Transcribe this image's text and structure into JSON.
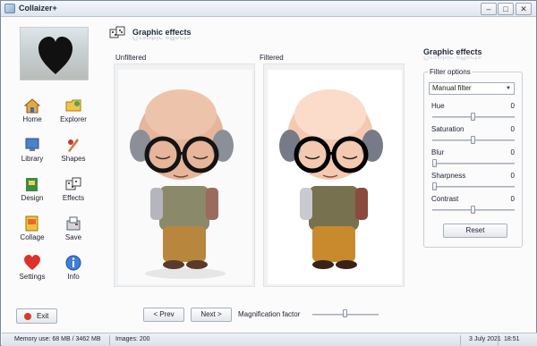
{
  "window": {
    "title": "Collaizer+",
    "min_glyph": "–",
    "max_glyph": "□",
    "close_glyph": "✕"
  },
  "sidebar": {
    "items": [
      {
        "label": "Home",
        "icon": "house-icon"
      },
      {
        "label": "Explorer",
        "icon": "folder-explorer-icon"
      },
      {
        "label": "Library",
        "icon": "monitor-library-icon"
      },
      {
        "label": "Shapes",
        "icon": "shapes-icon"
      },
      {
        "label": "Design",
        "icon": "design-icon"
      },
      {
        "label": "Effects",
        "icon": "dice-effects-icon"
      },
      {
        "label": "Collage",
        "icon": "collage-icon"
      },
      {
        "label": "Save",
        "icon": "save-icon"
      },
      {
        "label": "Settings",
        "icon": "heart-settings-icon"
      },
      {
        "label": "Info",
        "icon": "info-icon"
      }
    ],
    "exit_label": "Exit"
  },
  "header": {
    "title": "Graphic effects"
  },
  "preview": {
    "unfiltered_label": "Unfiltered",
    "filtered_label": "Filtered",
    "prev_label": "< Prev",
    "next_label": "Next >",
    "magnification_label": "Magnification factor",
    "magnification_level": 0.5
  },
  "effects_panel": {
    "title": "Graphic effects",
    "options_legend": "Filter options",
    "filter_selected": "Manual filter",
    "sliders": [
      {
        "label": "Hue",
        "value": "0",
        "level": 0.5
      },
      {
        "label": "Saturation",
        "value": "0",
        "level": 0.5
      },
      {
        "label": "Blur",
        "value": "0",
        "level": 0.0
      },
      {
        "label": "Sharpness",
        "value": "0",
        "level": 0.0
      },
      {
        "label": "Contrast",
        "value": "0",
        "level": 0.5
      }
    ],
    "reset_label": "Reset"
  },
  "status": {
    "memory": "Memory use: 68 MB / 3462 MB",
    "images": "Images: 200",
    "date": "3 July 2021",
    "time": "18:51"
  },
  "colors": {
    "accent": "#1d2a3c",
    "exit_icon": "#d63a2a"
  }
}
